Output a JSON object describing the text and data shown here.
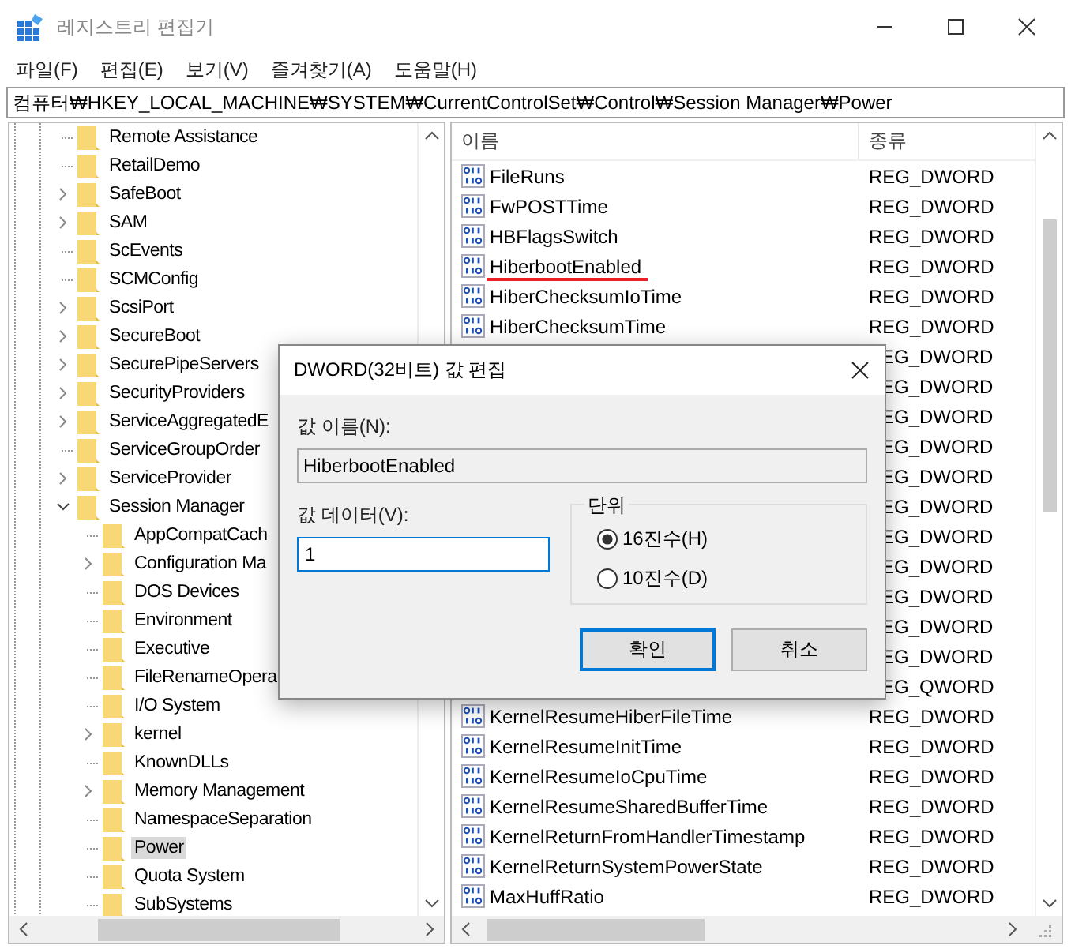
{
  "window": {
    "title": "레지스트리 편집기"
  },
  "menu": [
    "파일(F)",
    "편집(E)",
    "보기(V)",
    "즐겨찾기(A)",
    "도움말(H)"
  ],
  "address": "컴퓨터₩HKEY_LOCAL_MACHINE₩SYSTEM₩CurrentControlSet₩Control₩Session Manager₩Power",
  "tree": [
    {
      "label": "Remote Assistance",
      "expandable": false,
      "selected": false
    },
    {
      "label": "RetailDemo",
      "expandable": false,
      "selected": false
    },
    {
      "label": "SafeBoot",
      "expandable": true,
      "expanded": false,
      "selected": false
    },
    {
      "label": "SAM",
      "expandable": true,
      "expanded": false,
      "selected": false
    },
    {
      "label": "ScEvents",
      "expandable": false,
      "selected": false
    },
    {
      "label": "SCMConfig",
      "expandable": false,
      "selected": false
    },
    {
      "label": "ScsiPort",
      "expandable": true,
      "expanded": false,
      "selected": false
    },
    {
      "label": "SecureBoot",
      "expandable": true,
      "expanded": false,
      "selected": false
    },
    {
      "label": "SecurePipeServers",
      "expandable": true,
      "expanded": false,
      "selected": false
    },
    {
      "label": "SecurityProviders",
      "expandable": true,
      "expanded": false,
      "selected": false
    },
    {
      "label": "ServiceAggregatedE",
      "expandable": true,
      "expanded": false,
      "selected": false
    },
    {
      "label": "ServiceGroupOrder",
      "expandable": false,
      "selected": false
    },
    {
      "label": "ServiceProvider",
      "expandable": true,
      "expanded": false,
      "selected": false
    },
    {
      "label": "Session Manager",
      "expandable": true,
      "expanded": true,
      "selected": false,
      "children": [
        {
          "label": "AppCompatCach",
          "expandable": false,
          "selected": false
        },
        {
          "label": "Configuration Ma",
          "expandable": true,
          "expanded": false,
          "selected": false
        },
        {
          "label": "DOS Devices",
          "expandable": false,
          "selected": false
        },
        {
          "label": "Environment",
          "expandable": false,
          "selected": false
        },
        {
          "label": "Executive",
          "expandable": false,
          "selected": false
        },
        {
          "label": "FileRenameOpera",
          "expandable": false,
          "selected": false
        },
        {
          "label": "I/O System",
          "expandable": false,
          "selected": false
        },
        {
          "label": "kernel",
          "expandable": true,
          "expanded": false,
          "selected": false
        },
        {
          "label": "KnownDLLs",
          "expandable": false,
          "selected": false
        },
        {
          "label": "Memory Management",
          "expandable": true,
          "expanded": false,
          "selected": false
        },
        {
          "label": "NamespaceSeparation",
          "expandable": false,
          "selected": false
        },
        {
          "label": "Power",
          "expandable": false,
          "selected": true
        },
        {
          "label": "Quota System",
          "expandable": false,
          "selected": false
        },
        {
          "label": "SubSystems",
          "expandable": false,
          "selected": false
        }
      ]
    }
  ],
  "list": {
    "columns": [
      "이름",
      "종류"
    ],
    "rows": [
      {
        "kind": "value",
        "name": "FileRuns",
        "type": "REG_DWORD",
        "underlined": false
      },
      {
        "kind": "value",
        "name": "FwPOSTTime",
        "type": "REG_DWORD",
        "underlined": false
      },
      {
        "kind": "value",
        "name": "HBFlagsSwitch",
        "type": "REG_DWORD",
        "underlined": false
      },
      {
        "kind": "value",
        "name": "HiberbootEnabled",
        "type": "REG_DWORD",
        "underlined": true
      },
      {
        "kind": "value",
        "name": "HiberChecksumIoTime",
        "type": "REG_DWORD",
        "underlined": false
      },
      {
        "kind": "value",
        "name": "HiberChecksumTime",
        "type": "REG_DWORD",
        "underlined": false
      },
      {
        "kind": "covered",
        "type": "EG_DWORD"
      },
      {
        "kind": "covered",
        "type": "EG_DWORD"
      },
      {
        "kind": "covered",
        "type": "EG_DWORD"
      },
      {
        "kind": "covered",
        "type": "EG_DWORD"
      },
      {
        "kind": "covered",
        "type": "EG_DWORD"
      },
      {
        "kind": "covered",
        "type": "EG_DWORD"
      },
      {
        "kind": "covered",
        "type": "EG_DWORD"
      },
      {
        "kind": "covered",
        "type": "EG_DWORD"
      },
      {
        "kind": "covered",
        "type": "EG_DWORD"
      },
      {
        "kind": "covered",
        "type": "EG_DWORD"
      },
      {
        "kind": "covered",
        "type": "EG_DWORD"
      },
      {
        "kind": "covered",
        "type": "EG_QWORD"
      },
      {
        "kind": "value",
        "name": "KernelResumeHiberFileTime",
        "type": "REG_DWORD",
        "underlined": false
      },
      {
        "kind": "value",
        "name": "KernelResumeInitTime",
        "type": "REG_DWORD",
        "underlined": false
      },
      {
        "kind": "value",
        "name": "KernelResumeIoCpuTime",
        "type": "REG_DWORD",
        "underlined": false
      },
      {
        "kind": "value",
        "name": "KernelResumeSharedBufferTime",
        "type": "REG_DWORD",
        "underlined": false
      },
      {
        "kind": "value",
        "name": "KernelReturnFromHandlerTimestamp",
        "type": "REG_DWORD",
        "underlined": false
      },
      {
        "kind": "value",
        "name": "KernelReturnSystemPowerState",
        "type": "REG_DWORD",
        "underlined": false
      },
      {
        "kind": "value",
        "name": "MaxHuffRatio",
        "type": "REG_DWORD",
        "underlined": false
      }
    ]
  },
  "dialog": {
    "title": "DWORD(32비트) 값 편집",
    "name_label": "값 이름(N):",
    "name_value": "HiberbootEnabled",
    "data_label": "값 데이터(V):",
    "data_value": "1",
    "base_group": "단위",
    "bases": [
      {
        "label": "16진수(H)",
        "selected": true
      },
      {
        "label": "10진수(D)",
        "selected": false
      }
    ],
    "buttons": [
      {
        "label": "확인",
        "default": true
      },
      {
        "label": "취소",
        "default": false
      }
    ]
  }
}
